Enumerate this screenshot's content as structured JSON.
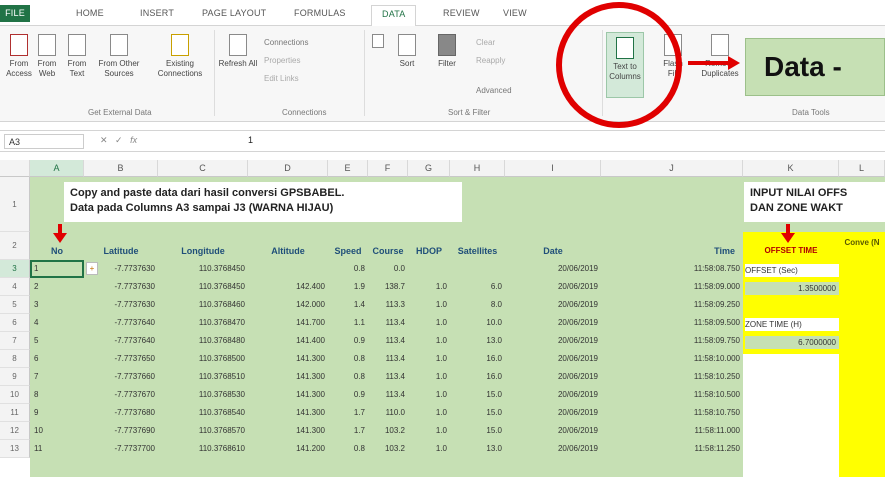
{
  "tabs": {
    "file": "FILE",
    "items": [
      "HOME",
      "INSERT",
      "PAGE LAYOUT",
      "FORMULAS",
      "DATA",
      "REVIEW",
      "VIEW"
    ],
    "active": "DATA"
  },
  "ribbon": {
    "get_external": {
      "from_access": "From Access",
      "from_web": "From Web",
      "from_text": "From Text",
      "from_other": "From Other Sources",
      "existing": "Existing Connections",
      "group_label": "Get External Data"
    },
    "connections": {
      "refresh": "Refresh All",
      "connections": "Connections",
      "properties": "Properties",
      "edit_links": "Edit Links",
      "group_label": "Connections"
    },
    "sort_filter": {
      "sort": "Sort",
      "filter": "Filter",
      "clear": "Clear",
      "reapply": "Reapply",
      "advanced": "Advanced",
      "group_label": "Sort & Filter"
    },
    "data_tools": {
      "text_to_columns": "Text to Columns",
      "flash_fill": "Flash Fill",
      "remove_duplicates": "Remove Duplicates",
      "group_label": "Data Tools"
    }
  },
  "callout": {
    "label": "Data -"
  },
  "formula_bar": {
    "name_box": "A3",
    "fx": "fx",
    "value": "1"
  },
  "columns": [
    "A",
    "B",
    "C",
    "D",
    "E",
    "F",
    "G",
    "H",
    "I",
    "J",
    "K",
    "L"
  ],
  "rows": [
    1,
    2,
    3,
    4,
    5,
    6,
    7,
    8,
    9,
    10,
    11,
    12,
    13
  ],
  "note": {
    "line1": "Copy and paste data dari hasil conversi GPSBABEL.",
    "line2": "Data pada Columns A3 sampai J3 (WARNA HIJAU)"
  },
  "input_note": {
    "line1": "INPUT NILAI OFFS",
    "line2": "DAN ZONE WAKT"
  },
  "headers": [
    "No",
    "Latitude",
    "Longitude",
    "Altitude",
    "Speed",
    "Course",
    "HDOP",
    "Satellites",
    "Date",
    "Time",
    "OFFSET TIME",
    "Conve (N"
  ],
  "table": [
    [
      "1",
      "-7.7737630",
      "110.3768450",
      "",
      "0.8",
      "0.0",
      "",
      "",
      "20/06/2019",
      "11:58:08.750"
    ],
    [
      "2",
      "-7.7737630",
      "110.3768450",
      "142.400",
      "1.9",
      "138.7",
      "1.0",
      "6.0",
      "20/06/2019",
      "11:58:09.000"
    ],
    [
      "3",
      "-7.7737630",
      "110.3768460",
      "142.000",
      "1.4",
      "113.3",
      "1.0",
      "8.0",
      "20/06/2019",
      "11:58:09.250"
    ],
    [
      "4",
      "-7.7737640",
      "110.3768470",
      "141.700",
      "1.1",
      "113.4",
      "1.0",
      "10.0",
      "20/06/2019",
      "11:58:09.500"
    ],
    [
      "5",
      "-7.7737640",
      "110.3768480",
      "141.400",
      "0.9",
      "113.4",
      "1.0",
      "13.0",
      "20/06/2019",
      "11:58:09.750"
    ],
    [
      "6",
      "-7.7737650",
      "110.3768500",
      "141.300",
      "0.8",
      "113.4",
      "1.0",
      "16.0",
      "20/06/2019",
      "11:58:10.000"
    ],
    [
      "7",
      "-7.7737660",
      "110.3768510",
      "141.300",
      "0.8",
      "113.4",
      "1.0",
      "16.0",
      "20/06/2019",
      "11:58:10.250"
    ],
    [
      "8",
      "-7.7737670",
      "110.3768530",
      "141.300",
      "0.9",
      "113.4",
      "1.0",
      "15.0",
      "20/06/2019",
      "11:58:10.500"
    ],
    [
      "9",
      "-7.7737680",
      "110.3768540",
      "141.300",
      "1.7",
      "110.0",
      "1.0",
      "15.0",
      "20/06/2019",
      "11:58:10.750"
    ],
    [
      "10",
      "-7.7737690",
      "110.3768570",
      "141.300",
      "1.7",
      "103.2",
      "1.0",
      "15.0",
      "20/06/2019",
      "11:58:11.000"
    ],
    [
      "11",
      "-7.7737700",
      "110.3768610",
      "141.200",
      "0.8",
      "103.2",
      "1.0",
      "13.0",
      "20/06/2019",
      "11:58:11.250"
    ]
  ],
  "side": {
    "offset_label": "OFFSET (Sec)",
    "offset_value": "1.3500000",
    "zone_label": "ZONE TIME (H)",
    "zone_value": "6.7000000"
  },
  "colors": {
    "excel_green": "#217346",
    "data_green": "#c6e0b4",
    "highlight_yellow": "#ffff00",
    "annotation_red": "#e00000"
  }
}
